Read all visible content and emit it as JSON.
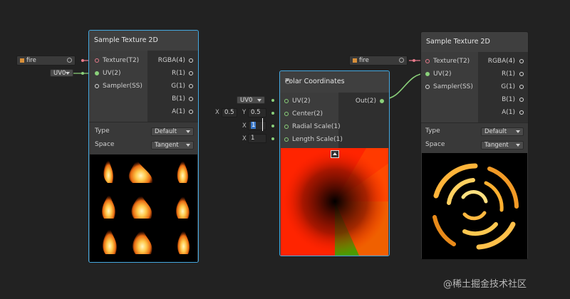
{
  "nodes": {
    "sample1": {
      "title": "Sample Texture 2D",
      "inputs": [
        "Texture(T2)",
        "UV(2)",
        "Sampler(SS)"
      ],
      "outputs": [
        "RGBA(4)",
        "R(1)",
        "G(1)",
        "B(1)",
        "A(1)"
      ],
      "type_label": "Type",
      "type_value": "Default",
      "space_label": "Space",
      "space_value": "Tangent"
    },
    "polar": {
      "title": "Polar Coordinates",
      "inputs": [
        "UV(2)",
        "Center(2)",
        "Radial Scale(1)",
        "Length Scale(1)"
      ],
      "outputs": [
        "Out(2)"
      ]
    },
    "sample2": {
      "title": "Sample Texture 2D",
      "inputs": [
        "Texture(T2)",
        "UV(2)",
        "Sampler(SS)"
      ],
      "outputs": [
        "RGBA(4)",
        "R(1)",
        "G(1)",
        "B(1)",
        "A(1)"
      ],
      "type_label": "Type",
      "type_value": "Default",
      "space_label": "Space",
      "space_value": "Tangent"
    }
  },
  "inline_inputs": {
    "texture1": "fire",
    "uv1": "UV0",
    "texture2": "fire",
    "uv_polar": "UV0",
    "center_x_label": "X",
    "center_x": "0.5",
    "center_y_label": "Y",
    "center_y": "0.5",
    "radial_x_label": "X",
    "radial_value": "1",
    "length_x_label": "X",
    "length_value": "1"
  },
  "watermark": "@稀土掘金技术社区",
  "colors": {
    "selection_border": "#44a8e0",
    "texture_port": "#e67a8a",
    "vector_port": "#8ad07a",
    "edge": "#8ad07a"
  }
}
